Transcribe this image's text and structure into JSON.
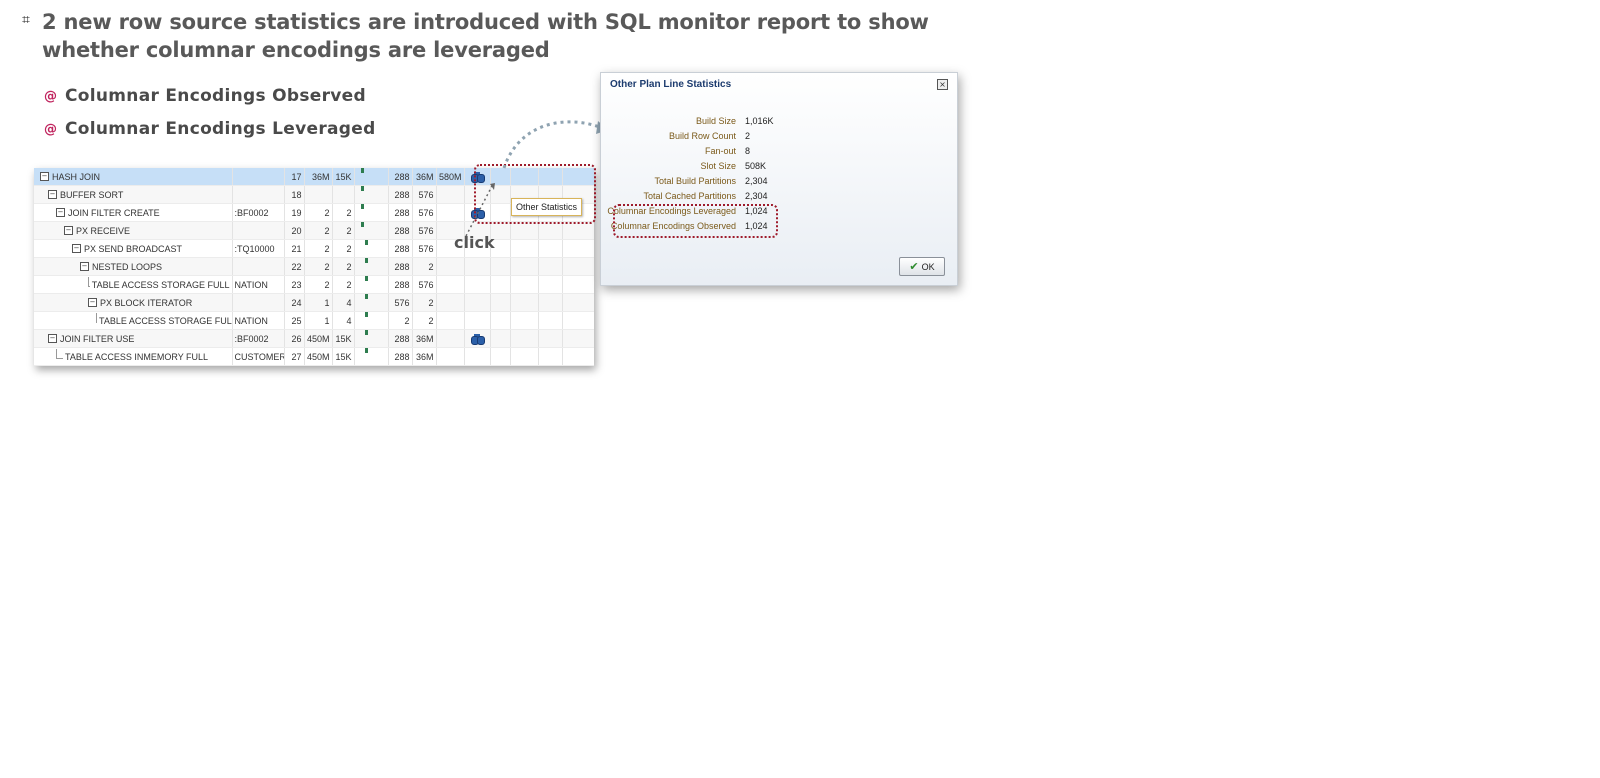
{
  "slide": {
    "title": "2 new row source statistics are introduced  with SQL monitor report to show whether columnar encodings are leveraged",
    "bullets": [
      "Columnar Encodings Observed",
      "Columnar Encodings Leveraged"
    ],
    "bullet_icon": "⌗",
    "sub_bullet_icon": "@",
    "colors": {
      "title": "#595959",
      "sub_bullet": "#c0245e",
      "highlight": "#9e1b2b"
    }
  },
  "plan": {
    "rows": [
      {
        "op": "HASH JOIN",
        "obj": "",
        "id": "17",
        "c1": "36M",
        "c2": "15K",
        "c3": "288",
        "c4": "36M",
        "c5": "580M",
        "stats": true,
        "selected": true
      },
      {
        "op": "BUFFER SORT",
        "obj": "",
        "id": "18",
        "c1": "",
        "c2": "",
        "c3": "288",
        "c4": "576",
        "c5": "",
        "stats": false
      },
      {
        "op": "JOIN FILTER CREATE",
        "obj": ":BF0002",
        "id": "19",
        "c1": "2",
        "c2": "2",
        "c3": "288",
        "c4": "576",
        "c5": "",
        "stats": true
      },
      {
        "op": "PX RECEIVE",
        "obj": "",
        "id": "20",
        "c1": "2",
        "c2": "2",
        "c3": "288",
        "c4": "576",
        "c5": "",
        "stats": false
      },
      {
        "op": "PX SEND BROADCAST",
        "obj": ":TQ10000",
        "id": "21",
        "c1": "2",
        "c2": "2",
        "c3": "288",
        "c4": "576",
        "c5": "",
        "stats": false
      },
      {
        "op": "NESTED LOOPS",
        "obj": "",
        "id": "22",
        "c1": "2",
        "c2": "2",
        "c3": "288",
        "c4": "2",
        "c5": "",
        "stats": false
      },
      {
        "op": "TABLE ACCESS STORAGE FULL",
        "obj": "NATION",
        "id": "23",
        "c1": "2",
        "c2": "2",
        "c3": "288",
        "c4": "576",
        "c5": "",
        "stats": false
      },
      {
        "op": "PX BLOCK ITERATOR",
        "obj": "",
        "id": "24",
        "c1": "1",
        "c2": "4",
        "c3": "576",
        "c4": "2",
        "c5": "",
        "stats": false
      },
      {
        "op": "TABLE ACCESS STORAGE FULL",
        "obj": "NATION",
        "id": "25",
        "c1": "1",
        "c2": "4",
        "c3": "2",
        "c4": "2",
        "c5": "",
        "stats": false
      },
      {
        "op": "JOIN FILTER USE",
        "obj": ":BF0002",
        "id": "26",
        "c1": "450M",
        "c2": "15K",
        "c3": "288",
        "c4": "36M",
        "c5": "",
        "stats": true
      },
      {
        "op": "TABLE ACCESS INMEMORY FULL",
        "obj": "CUSTOMER",
        "id": "27",
        "c1": "450M",
        "c2": "15K",
        "c3": "288",
        "c4": "36M",
        "c5": "",
        "stats": false
      }
    ],
    "tooltip": "Other Statistics",
    "click_label": "click"
  },
  "dialog": {
    "title": "Other Plan Line Statistics",
    "close_icon": "×",
    "stats": [
      {
        "label": "Build Size",
        "value": "1,016K"
      },
      {
        "label": "Build Row Count",
        "value": "2"
      },
      {
        "label": "Fan-out",
        "value": "8"
      },
      {
        "label": "Slot Size",
        "value": "508K"
      },
      {
        "label": "Total Build Partitions",
        "value": "2,304"
      },
      {
        "label": "Total Cached Partitions",
        "value": "2,304"
      },
      {
        "label": "Columnar Encodings Leveraged",
        "value": "1,024"
      },
      {
        "label": "Columnar Encodings Observed",
        "value": "1,024"
      }
    ],
    "ok_label": "OK",
    "ok_icon": "✔"
  }
}
